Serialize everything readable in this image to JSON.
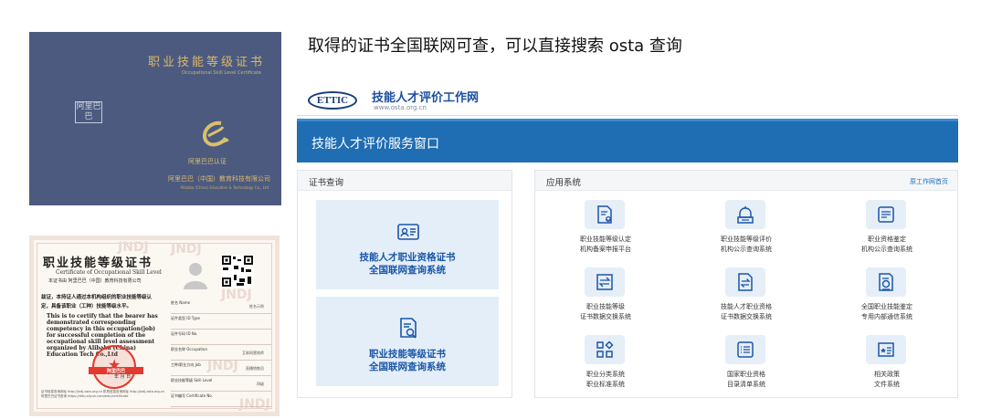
{
  "cover": {
    "title_cn": "职业技能等级证书",
    "title_en": "Occupational Skill Level Certificate",
    "seal_text": "阿里巴巴",
    "logo_text": "阿里巴巴认证",
    "company_cn": "阿里巴巴（中国）教育科技有限公司",
    "company_en": "Alibaba (China) Education & Technology Co., Ltd"
  },
  "certificate": {
    "title_cn": "职业技能等级证书",
    "title_en": "Certificate of Occupational Skill Level",
    "issuer": "本证书由  阿里巴巴（中国）教育科技有限公司",
    "body_cn": "兹证，本持证人通过本机构组织的职业技能等级认定，具备该职业（工种）技能等级水平。",
    "body_en": "This is to certify that the bearer has demonstrated corresponding competency in this occupation(job) for successful completion of the occupational skill level assessment organized by Alibaba (China) Education Tech Co.,Ltd",
    "fields": [
      {
        "label": "姓名 Name",
        "value": "姓名示例"
      },
      {
        "label": "证件类型 ID Type",
        "value": ""
      },
      {
        "label": "证件号码 ID No.",
        "value": ""
      },
      {
        "label": "职业名称 Occupation",
        "value": "互联网营销师"
      },
      {
        "label": "工种/职业方向 Job",
        "value": "直播销售员"
      },
      {
        "label": "职业技能等级 Skill Level",
        "value": "四级"
      },
      {
        "label": "证书编号 Certificate No.",
        "value": ""
      }
    ],
    "stamp_text": "阿里巴巴",
    "date": "年    月    日",
    "footer": "证书信息查询网址 http://jndj.osta.org.cn  机构信息查询网址 http://jndj.osta.org.cn 阿里巴巴证书查询 https://ditu.aliyun.com/edu/certificate",
    "watermark": "JNDJ"
  },
  "heading": "取得的证书全国联网可查，可以直接搜索 osta 查询",
  "site": {
    "logo": "ETTIC",
    "brand_cn": "技能人才评价工作网",
    "brand_url": "www.osta.org.cn",
    "banner": "技能人才评价服务窗口",
    "cert_panel": {
      "title": "证书查询",
      "items": [
        {
          "line1": "技能人才职业资格证书",
          "line2": "全国联网查询系统"
        },
        {
          "line1": "职业技能等级证书",
          "line2": "全国联网查询系统"
        }
      ]
    },
    "app_panel": {
      "title": "应用系统",
      "link": "原工作网首页",
      "apps": [
        {
          "icon": "doc-upload-icon",
          "line1": "职业技能等级认定",
          "line2": "机构备案申报平台"
        },
        {
          "icon": "bell-doc-icon",
          "line1": "职业技能等级评价",
          "line2": "机构公示查询系统"
        },
        {
          "icon": "doc-list-icon",
          "line1": "职业资格鉴定",
          "line2": "机构公示查询系统"
        },
        {
          "icon": "exchange-icon",
          "line1": "职业技能等级",
          "line2": "证书数据交换系统"
        },
        {
          "icon": "exchange-doc-icon",
          "line1": "技能人才职业资格",
          "line2": "证书数据交换系统"
        },
        {
          "icon": "doc-search-icon",
          "line1": "全国职业技能鉴定",
          "line2": "专用内部通信系统"
        },
        {
          "icon": "category-icon",
          "line1": "职业分类系统",
          "line2": "职业标准系统"
        },
        {
          "icon": "list-icon",
          "line1": "国家职业资格",
          "line2": "目录清单系统"
        },
        {
          "icon": "policy-book-icon",
          "line1": "相关政策",
          "line2": "文件系统"
        }
      ]
    }
  }
}
